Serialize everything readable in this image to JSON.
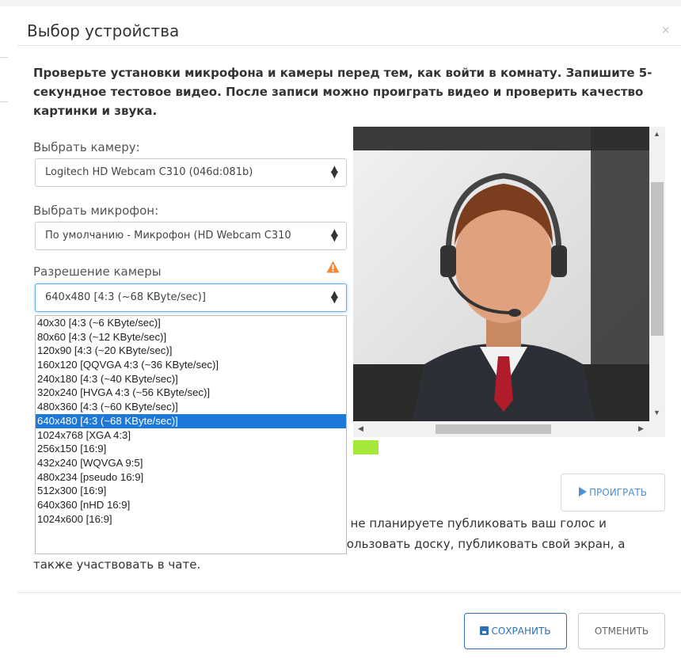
{
  "dialog": {
    "title": "Выбор устройства",
    "close": "×",
    "intro": "Проверьте установки микрофона и камеры перед тем, как войти в комнату. Запишите 5-секундное тестовое видео. После записи можно проиграть видео и проверить качество картинки и звука."
  },
  "camera": {
    "label": "Выбрать камеру:",
    "value": "Logitech HD Webcam C310 (046d:081b)"
  },
  "microphone": {
    "label": "Выбрать микрофон:",
    "value": "По умолчанию - Микрофон (HD Webcam C310"
  },
  "resolution": {
    "label": "Разрешение камеры",
    "value": "640x480 [4:3 (~68 KByte/sec)]",
    "options": [
      "40x30 [4:3 (~6 KByte/sec)]",
      "80x60 [4:3 (~12 KByte/sec)]",
      "120x90 [4:3 (~20 KByte/sec)]",
      "160x120 [QQVGA 4:3 (~36 KByte/sec)]",
      "240x180 [4:3 (~40 KByte/sec)]",
      "320x240 [HVGA 4:3 (~56 KByte/sec)]",
      "480x360 [4:3 (~60 KByte/sec)]",
      "640x480 [4:3 (~68 KByte/sec)]",
      "1024x768 [XGA 4:3]",
      "256x150 [16:9]",
      "432x240 [WQVGA 9:5]",
      "480x234 [pseudo 16:9]",
      "512x300 [16:9]",
      "640x360 [nHD 16:9]",
      "1024x600 [16:9]"
    ],
    "selected_index": 7
  },
  "preview": {
    "play_label": "ПРОИГРАТЬ"
  },
  "note": {
    "line1": "и не планируете публиковать ваш голос и",
    "line2": "пользовать доску, публиковать свой экран, а",
    "line3": "также участвовать в чате."
  },
  "footer": {
    "save_label": "СОХРАНИТЬ",
    "cancel_label": "ОТМЕНИТЬ"
  },
  "colors": {
    "accent": "#1e78d7",
    "level": "#a4e83a",
    "warning": "#f0883a"
  }
}
